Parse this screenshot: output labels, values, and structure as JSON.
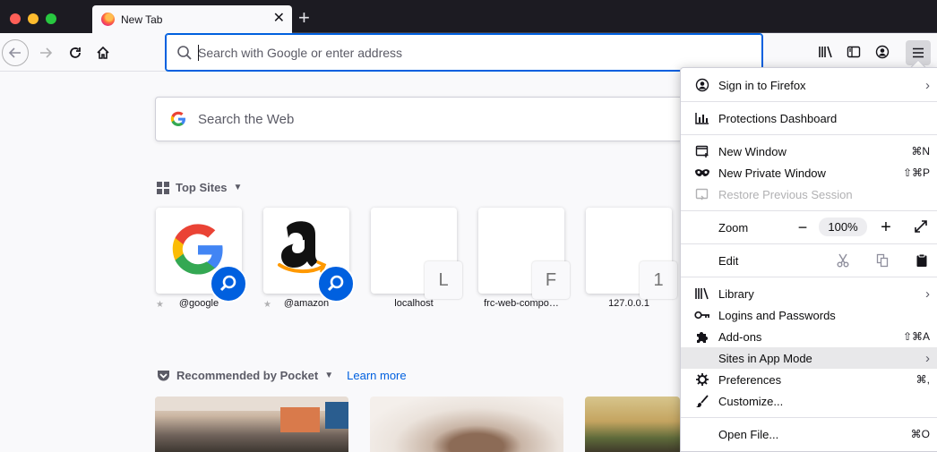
{
  "tab": {
    "title": "New Tab",
    "close_glyph": "✕"
  },
  "new_tab_glyph": "+",
  "urlbar": {
    "placeholder": "Search with Google or enter address",
    "value": ""
  },
  "search": {
    "placeholder": "Search the Web",
    "icon": "google-g-icon"
  },
  "top_sites": {
    "heading": "Top Sites",
    "items": [
      {
        "label": "@google",
        "letter": "",
        "pinned": true,
        "icon": "google-logo-icon"
      },
      {
        "label": "@amazon",
        "letter": "",
        "pinned": true,
        "icon": "amazon-logo-icon"
      },
      {
        "label": "localhost",
        "letter": "L",
        "pinned": false
      },
      {
        "label": "frc-web-compo…",
        "letter": "F",
        "pinned": false
      },
      {
        "label": "127.0.0.1",
        "letter": "1",
        "pinned": false
      }
    ]
  },
  "pocket": {
    "heading": "Recommended by Pocket",
    "learn_more": "Learn more"
  },
  "app_menu": {
    "sign_in": "Sign in to Firefox",
    "protections": "Protections Dashboard",
    "new_window": {
      "label": "New Window",
      "shortcut": "⌘N"
    },
    "new_private_window": {
      "label": "New Private Window",
      "shortcut": "⇧⌘P"
    },
    "restore_session": "Restore Previous Session",
    "zoom": {
      "label": "Zoom",
      "minus": "−",
      "value": "100%",
      "plus": "+"
    },
    "edit": {
      "label": "Edit"
    },
    "library": "Library",
    "logins": "Logins and Passwords",
    "addons": {
      "label": "Add-ons",
      "shortcut": "⇧⌘A"
    },
    "sites_app_mode": "Sites in App Mode",
    "preferences": {
      "label": "Preferences",
      "shortcut": "⌘,"
    },
    "customize": "Customize...",
    "open_file": {
      "label": "Open File...",
      "shortcut": "⌘O"
    }
  },
  "colors": {
    "accent": "#0060df",
    "titlebar": "#1c1b22",
    "page_bg": "#f9f9fb"
  }
}
